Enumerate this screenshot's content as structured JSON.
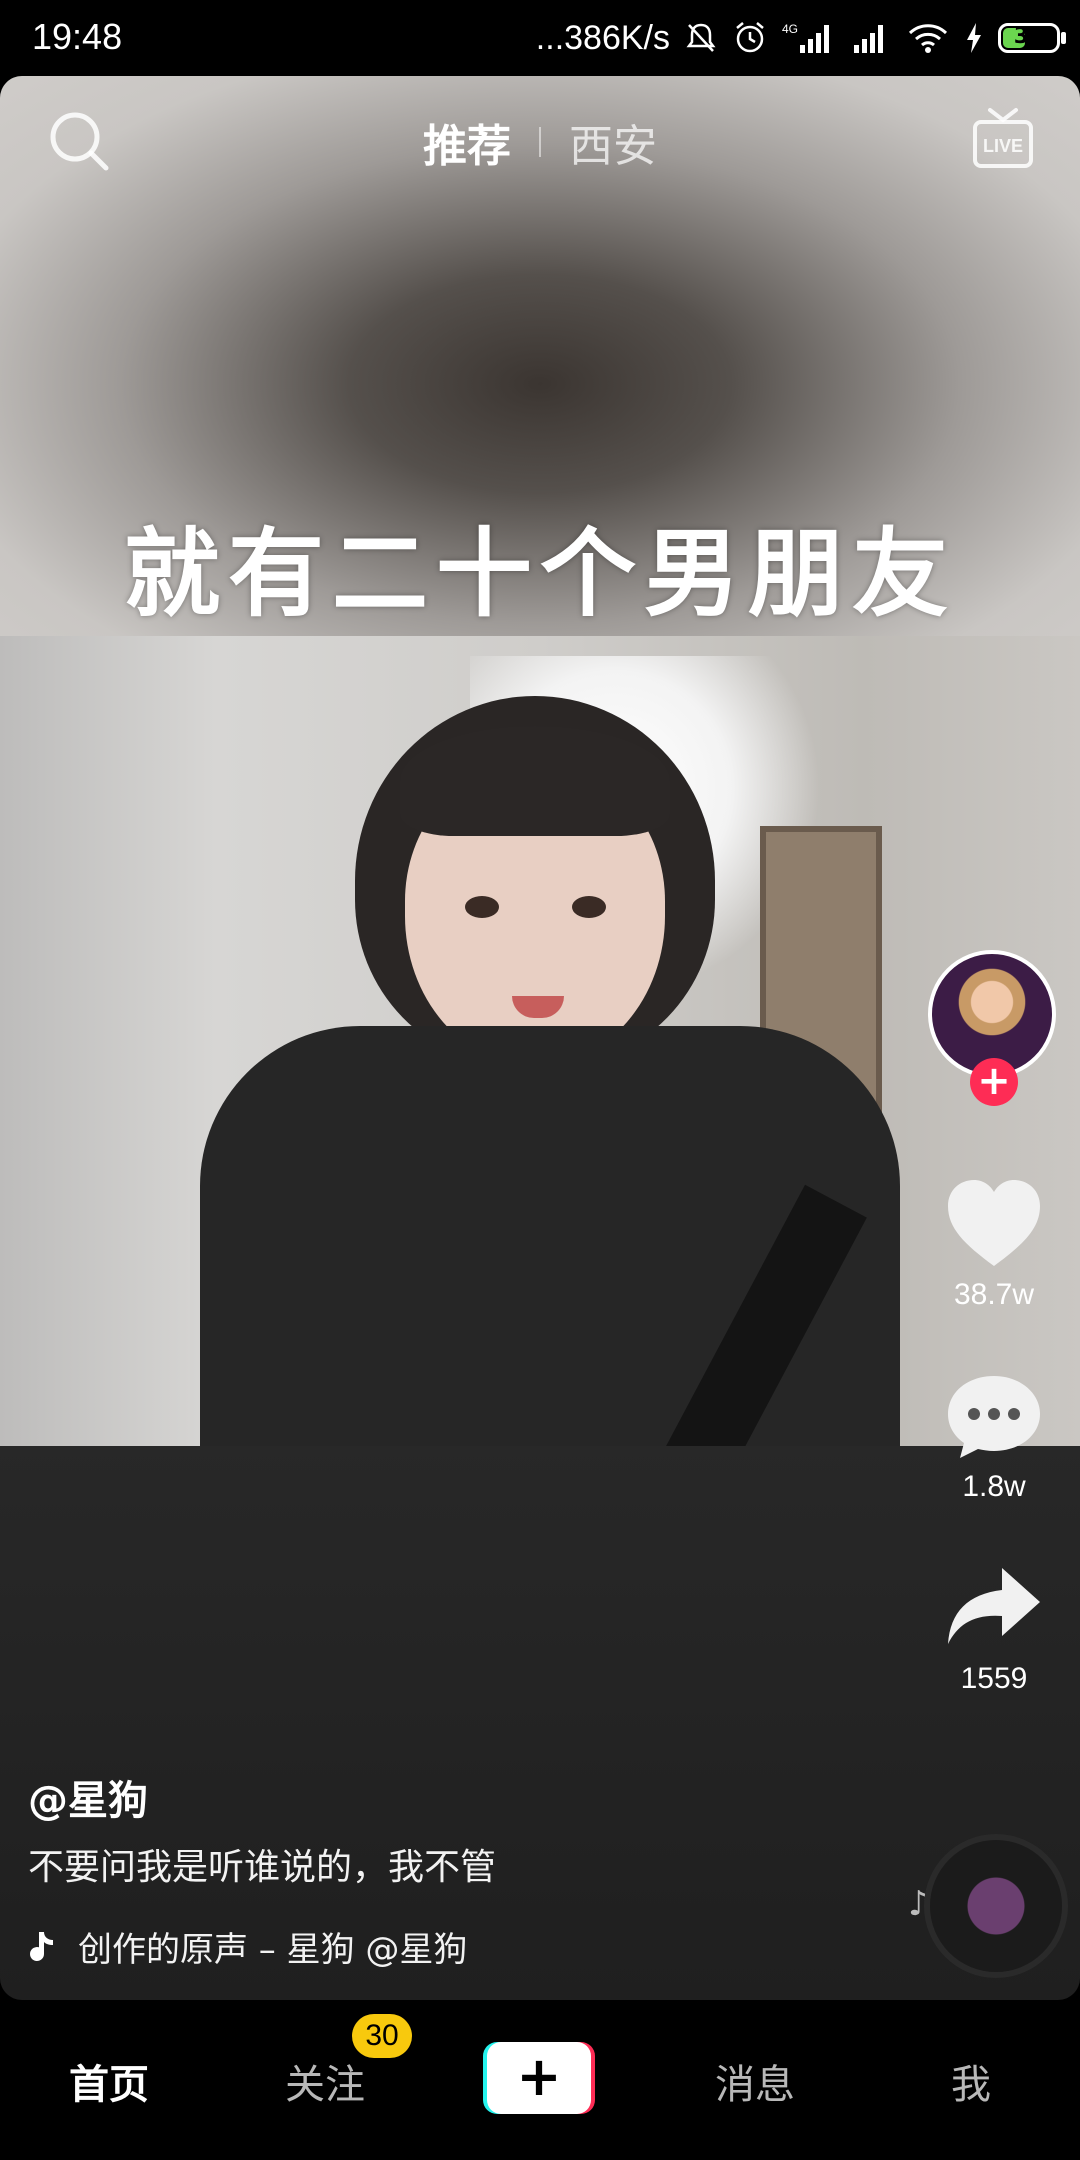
{
  "status_bar": {
    "time": "19:48",
    "net_speed": "...386K/s",
    "network_type": "4G",
    "battery": "30",
    "icons": [
      "mute-bell-icon",
      "alarm-icon",
      "signal-icon",
      "signal-icon",
      "wifi-icon",
      "charging-icon",
      "battery-icon"
    ]
  },
  "top_tabs": {
    "recommend": "推荐",
    "city": "西安",
    "active": "recommend"
  },
  "live_label": "LIVE",
  "video": {
    "subtitle": "就有二十个男朋友"
  },
  "right_rail": {
    "likes": "38.7w",
    "comments": "1.8w",
    "shares": "1559",
    "follow_symbol": "+"
  },
  "info": {
    "author": "@星狗",
    "description": "不要问我是听谁说的，我不管",
    "music": "创作的原声 – 星狗    @星狗"
  },
  "bottom_nav": {
    "home": "首页",
    "following": "关注",
    "following_badge": "30",
    "create": "+",
    "messages": "消息",
    "me": "我"
  },
  "colors": {
    "accent_red": "#fe2c55",
    "accent_cyan": "#25f4ee",
    "badge_yellow": "#f8c90d"
  }
}
